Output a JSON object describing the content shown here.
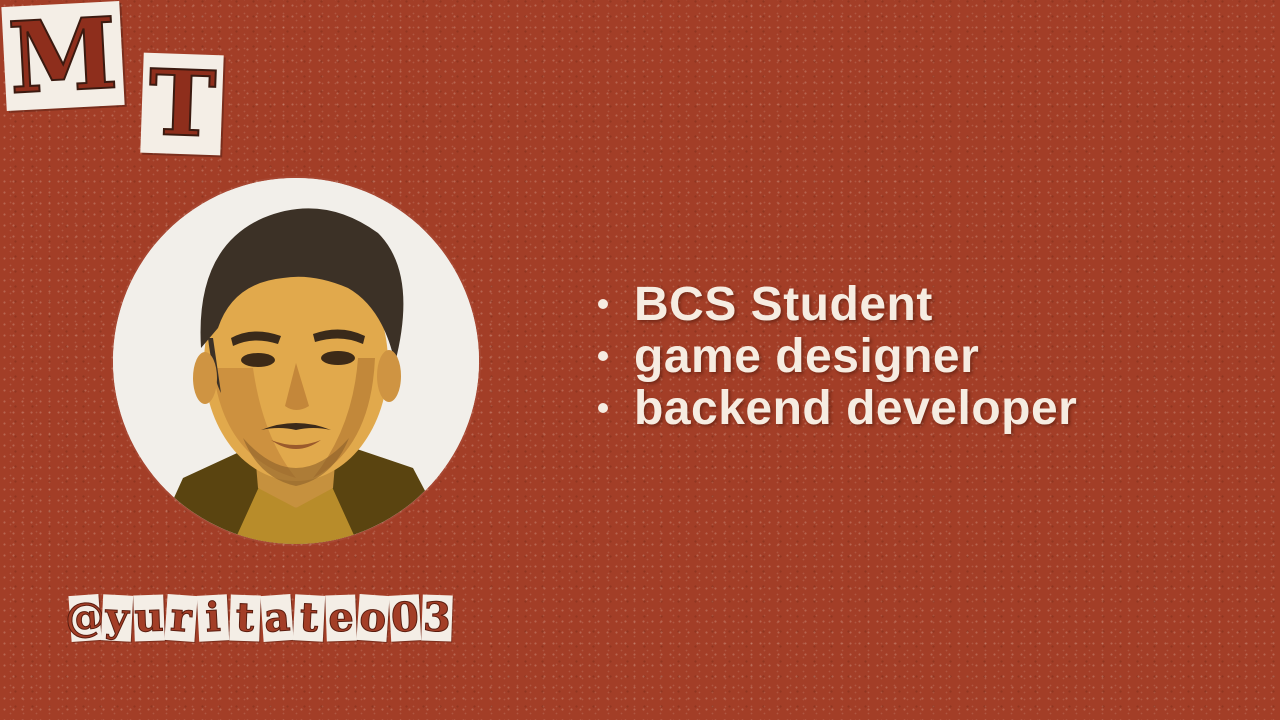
{
  "logo": {
    "letters": [
      "M",
      "T"
    ]
  },
  "avatar": {
    "icon": "portrait-illustration"
  },
  "bullets": [
    {
      "label": "BCS Student"
    },
    {
      "label": "game designer"
    },
    {
      "label": "backend developer"
    }
  ],
  "handle": {
    "text": "@yuritateo03"
  },
  "colors": {
    "background": "#a33e27",
    "text": "#f6ece1",
    "paper": "#f4eee6"
  }
}
